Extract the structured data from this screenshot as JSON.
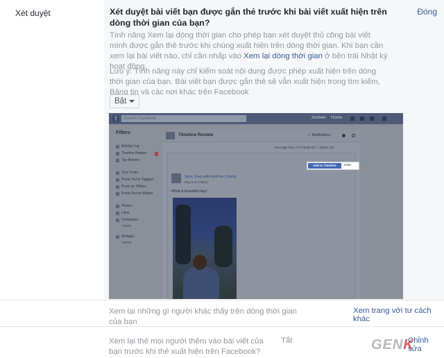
{
  "left_label": "Xét duyệt",
  "section": {
    "close": "Đóng",
    "question": "Xét duyệt bài viết bạn được gắn thẻ trước khi bài viết xuất hiện trên dòng thời gian của bạn?",
    "desc_part1": "Tính năng Xem lại dòng thời gian cho phép bạn xét duyệt thủ công bài viết mình được gắn thẻ trước khi chúng xuất hiện trên dòng thời gian. Khi bạn cần xem lại bài viết nào, chỉ cần nhấp vào ",
    "desc_link": "Xem lại dòng thời gian",
    "desc_part2": " ở bên trái Nhật ký hoạt động.",
    "note": "Lưu ý: Tính năng này chỉ kiểm soát nội dung được phép xuất hiện trên dòng thời gian của bạn. Bài viết bạn được gắn thẻ sẽ vẫn xuất hiện trong tìm kiếm, Bảng tin và các nơi khác trên Facebook",
    "toggle_value": "Bật"
  },
  "preview": {
    "search_placeholder": "Search Facebook",
    "user": "Andrew",
    "home": "Home",
    "filters_title": "Filters",
    "filters": [
      "Activity Log",
      "Timeline Review",
      "Tag Review"
    ],
    "filters2": [
      "Your Posts",
      "Posts You're Tagged...",
      "Posts by Others",
      "Posts You've Hidden"
    ],
    "filters3": [
      "Photos",
      "Likes",
      "Comments"
    ],
    "more1": "MORE",
    "filters4": [
      "All Apps"
    ],
    "more2": "MORE",
    "header_title": "Timeline Review",
    "notifications": "✓ Notifications",
    "view_tags": "View tags from:  ☑ Friends (0)   ☐ Others (0)",
    "add_btn": "Add to Timeline",
    "hide_btn": "Hide",
    "poster_name": "Sara Jong",
    "poster_with": " with ",
    "poster_friend": "Andrew Chang",
    "post_date": "May 8 at 4:00pm · ",
    "post_text": "What a beautiful day!"
  },
  "rows": [
    {
      "text": "Xem lại những gì người khác thấy trên dòng thời gian của bạn",
      "value": "",
      "link": "Xem trang với tư cách khác"
    },
    {
      "text": "Xem lại thẻ mọi người thêm vào bài viết của bạn trước khi thẻ xuất hiện trên Facebook?",
      "value": "Tắt",
      "link": "Chỉnh sửa"
    }
  ],
  "watermark": {
    "left": "GEN",
    "right": "K"
  }
}
